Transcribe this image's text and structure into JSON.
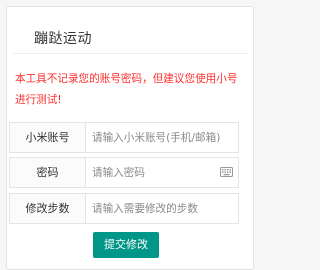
{
  "panel": {
    "title": "蹦跶运动",
    "warning": "本工具不记录您的账号密码，但建议您使用小号进行测试!"
  },
  "form": {
    "fields": [
      {
        "label": "小米账号",
        "placeholder": "请输入小米账号(手机/邮箱)",
        "value": ""
      },
      {
        "label": "密码",
        "placeholder": "请输入密码",
        "value": ""
      },
      {
        "label": "修改步数",
        "placeholder": "请输入需要修改的步数",
        "value": ""
      }
    ],
    "password_keyboard_icon": "keyboard-icon",
    "submit_label": "提交修改"
  },
  "colors": {
    "warning": "#ff2d2d",
    "submit_button": "#009688"
  }
}
